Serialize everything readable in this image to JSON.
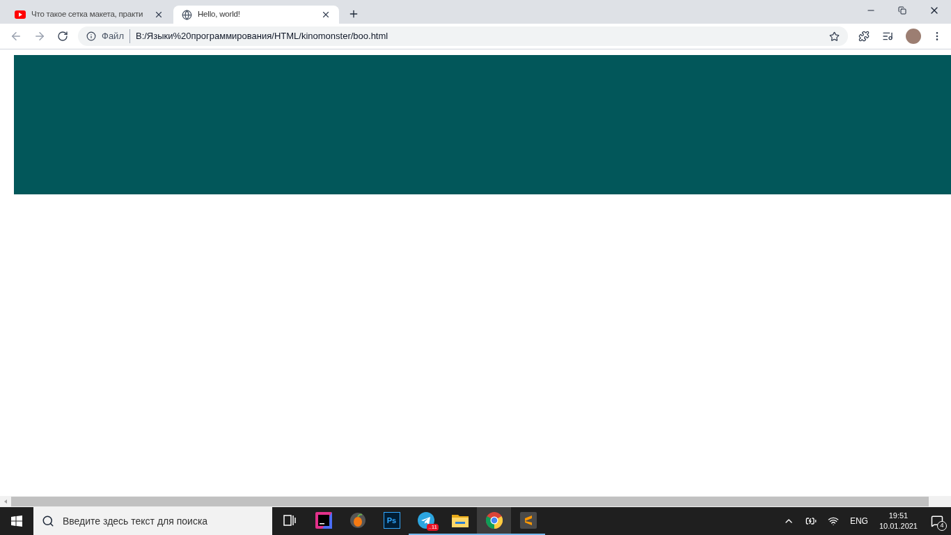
{
  "browser": {
    "tabs": [
      {
        "title": "Что такое сетка макета, практи",
        "kind": "video",
        "selected": false
      },
      {
        "title": "Hello, world!",
        "kind": "globe",
        "selected": true
      }
    ],
    "address": {
      "scheme": "Файл",
      "url": "B:/Языки%20программирования/HTML/kinomonster/boo.html"
    }
  },
  "page": {
    "banner": {
      "color": "#02575a"
    }
  },
  "taskbar": {
    "search": {
      "placeholder": "Введите здесь текст для поиска"
    },
    "apps": [
      {
        "kind": "taskview",
        "running": false,
        "selected": false
      },
      {
        "kind": "ide",
        "running": false,
        "selected": false
      },
      {
        "kind": "fruit",
        "running": false,
        "selected": false
      },
      {
        "kind": "ps",
        "label": "Ps",
        "running": false,
        "selected": false
      },
      {
        "kind": "telegram",
        "badge": "..11",
        "running": true,
        "selected": false
      },
      {
        "kind": "folder",
        "running": true,
        "selected": false
      },
      {
        "kind": "chrome",
        "running": true,
        "selected": true
      },
      {
        "kind": "sublime",
        "running": true,
        "selected": false
      }
    ],
    "language": "ENG",
    "time": "19:51",
    "date": "10.01.2021",
    "notifications": "4"
  }
}
